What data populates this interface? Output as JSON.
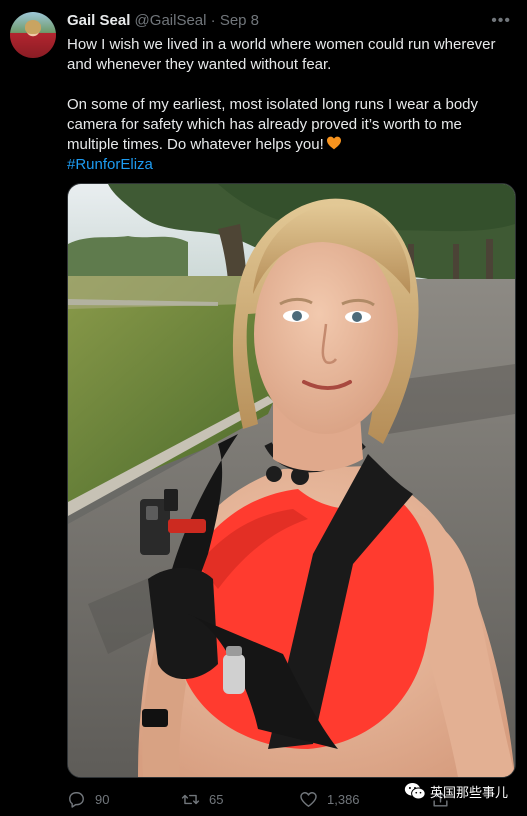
{
  "tweet": {
    "author_name": "Gail Seal",
    "author_handle": "@GailSeal",
    "separator": "·",
    "date": "Sep 8",
    "more_icon": "more-horizontal-icon",
    "text_line1": "How I wish we lived in a world where women could run wherever and whenever they wanted without fear.",
    "text_line2": "On some of my earliest, most isolated long runs I wear a body camera for safety which has already proved it’s worth to me multiple times. Do whatever helps you!",
    "heart_emoji_color": "#f7931e",
    "hashtag": "#RunforEliza",
    "hashtag_color": "#1d9bf0"
  },
  "actions": {
    "reply_count": "90",
    "retweet_count": "65",
    "like_count": "1,386",
    "reply_icon": "reply-icon",
    "retweet_icon": "retweet-icon",
    "like_icon": "heart-icon",
    "share_icon": "share-icon"
  },
  "watermark": {
    "text": "英国那些事儿",
    "icon": "wechat-icon"
  },
  "colors": {
    "background": "#000000",
    "text": "#e7e9ea",
    "muted": "#71767b",
    "accent": "#1d9bf0"
  }
}
